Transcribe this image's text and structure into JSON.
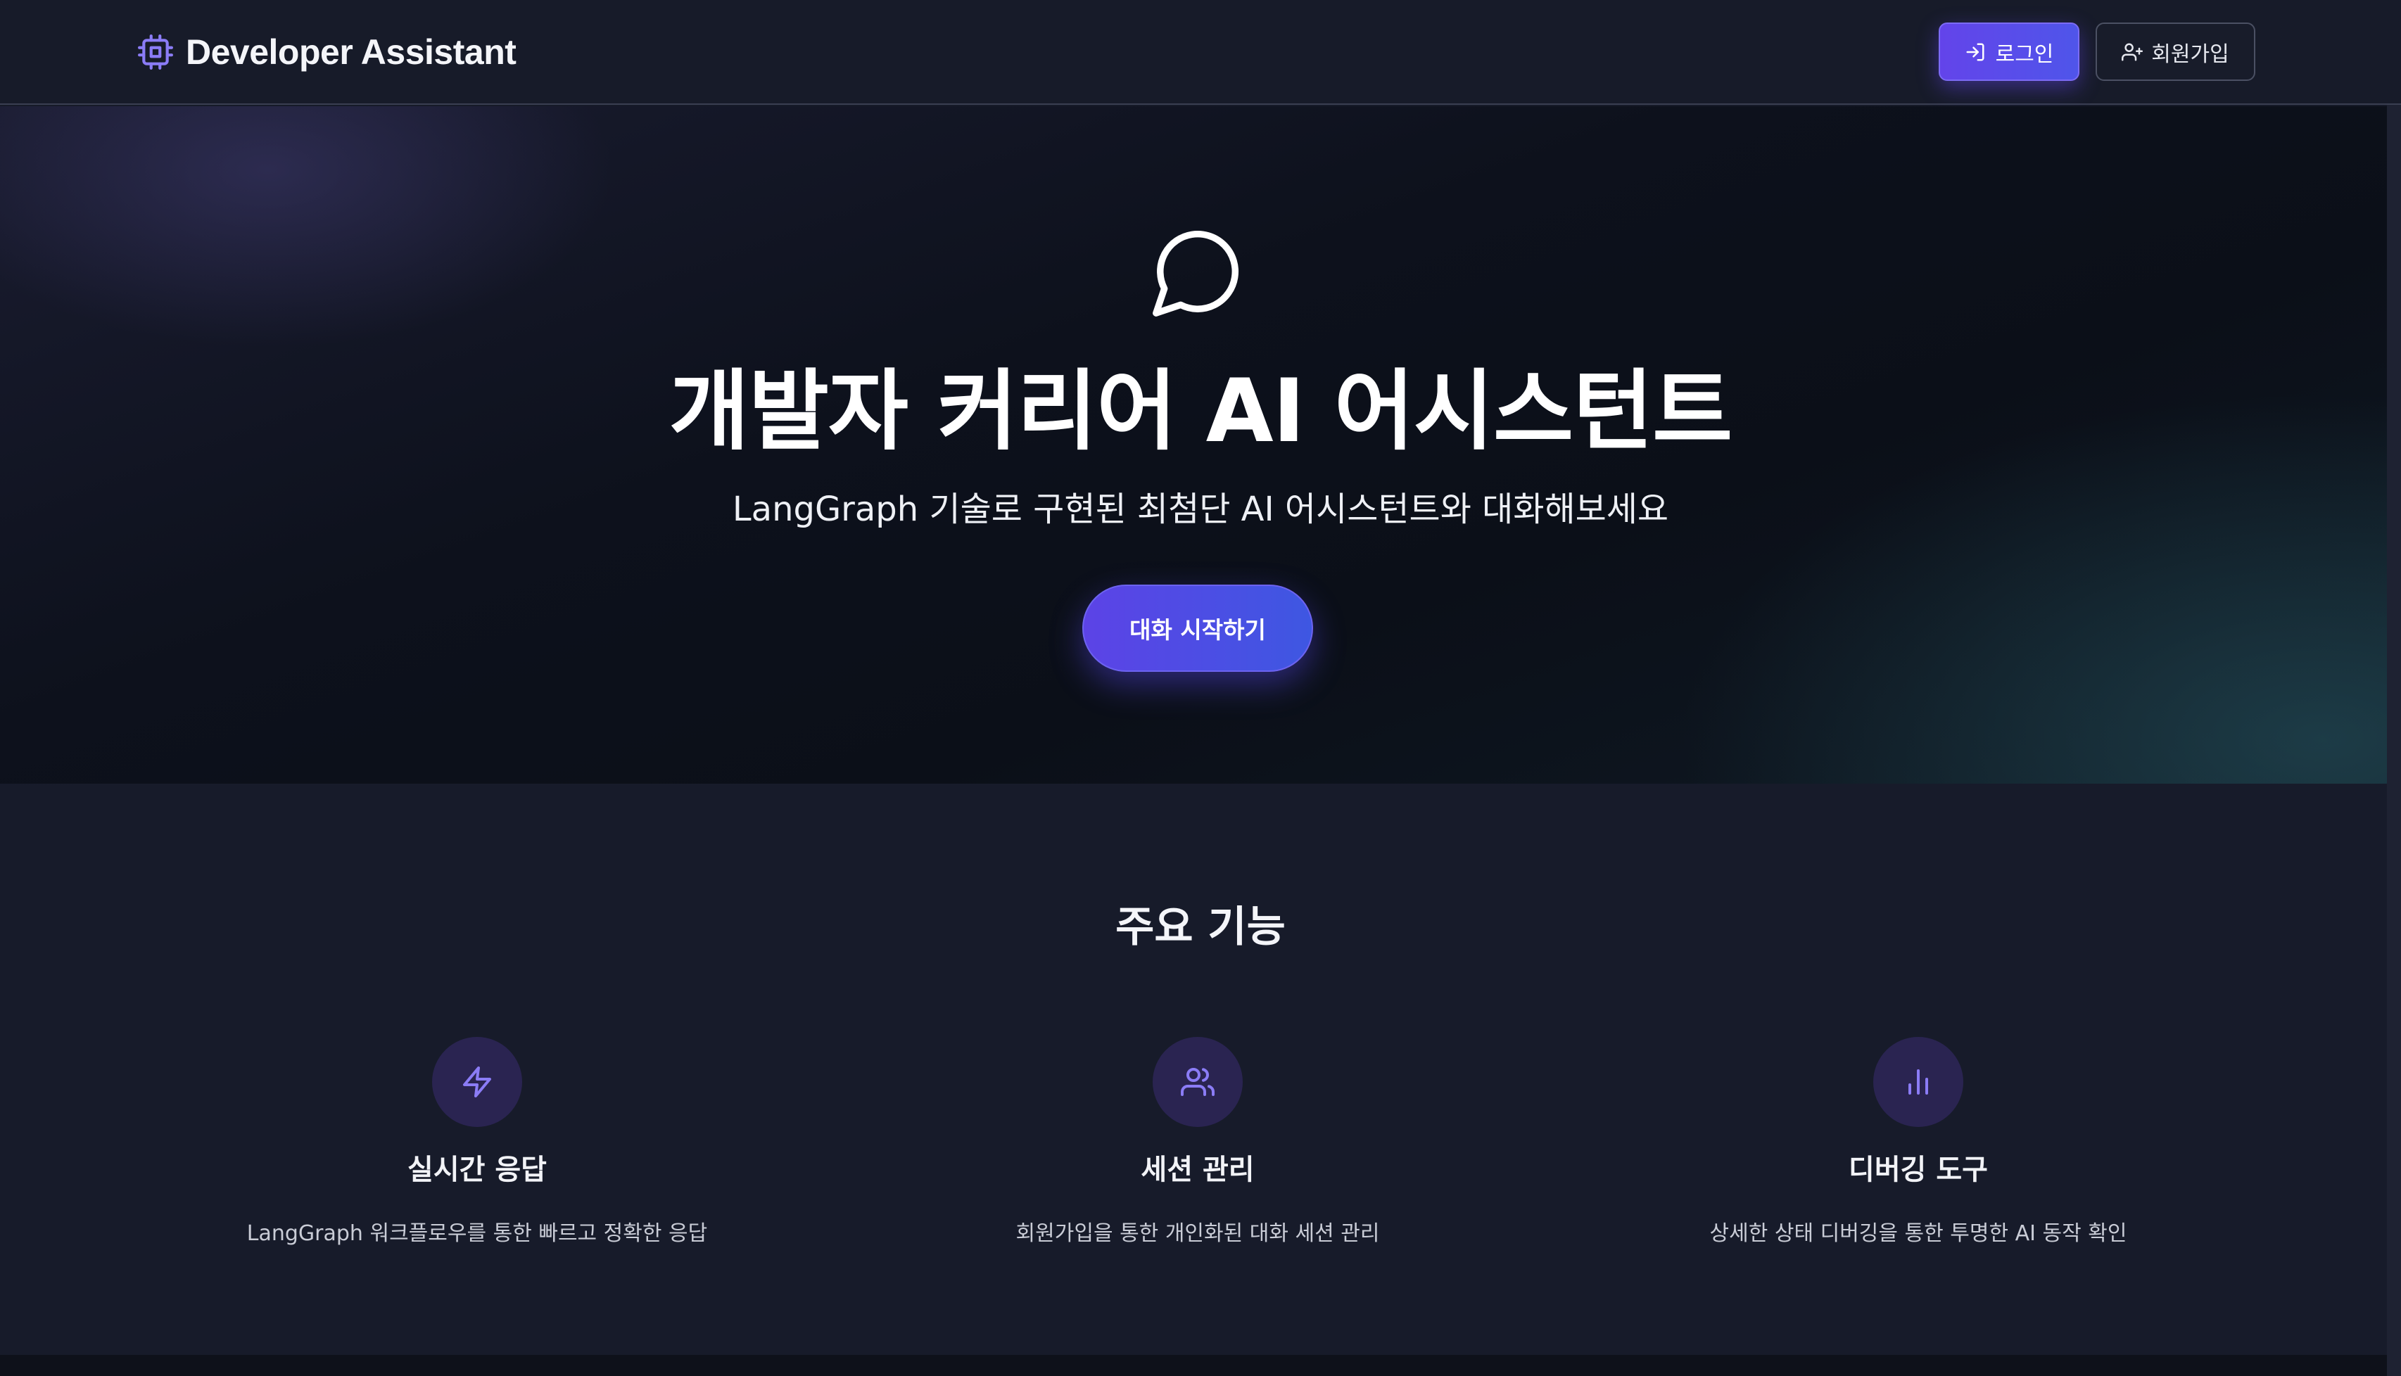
{
  "header": {
    "brand_name": "Developer Assistant",
    "brand_icon": "cpu-chip-icon",
    "login_label": "로그인",
    "login_icon": "log-in-icon",
    "signup_label": "회원가입",
    "signup_icon": "user-plus-icon"
  },
  "hero": {
    "icon": "message-circle-icon",
    "title": "개발자 커리어 AI 어시스턴트",
    "subtitle": "LangGraph 기술로 구현된 최첨단 AI 어시스턴트와 대화해보세요",
    "cta_label": "대화 시작하기"
  },
  "features": {
    "title": "주요 기능",
    "items": [
      {
        "icon": "lightning-bolt-icon",
        "title": "실시간 응답",
        "description": "LangGraph 워크플로우를 통한 빠르고 정확한 응답"
      },
      {
        "icon": "users-icon",
        "title": "세션 관리",
        "description": "회원가입을 통한 개인화된 대화 세션 관리"
      },
      {
        "icon": "bar-chart-icon",
        "title": "디버깅 도구",
        "description": "상세한 상태 디버깅을 통한 투명한 AI 동작 확인"
      }
    ]
  },
  "colors": {
    "accent_purple": "#5c43e6",
    "accent_blue": "#3e57e2",
    "icon_purple": "#8b7cf6",
    "background": "#161a28"
  }
}
